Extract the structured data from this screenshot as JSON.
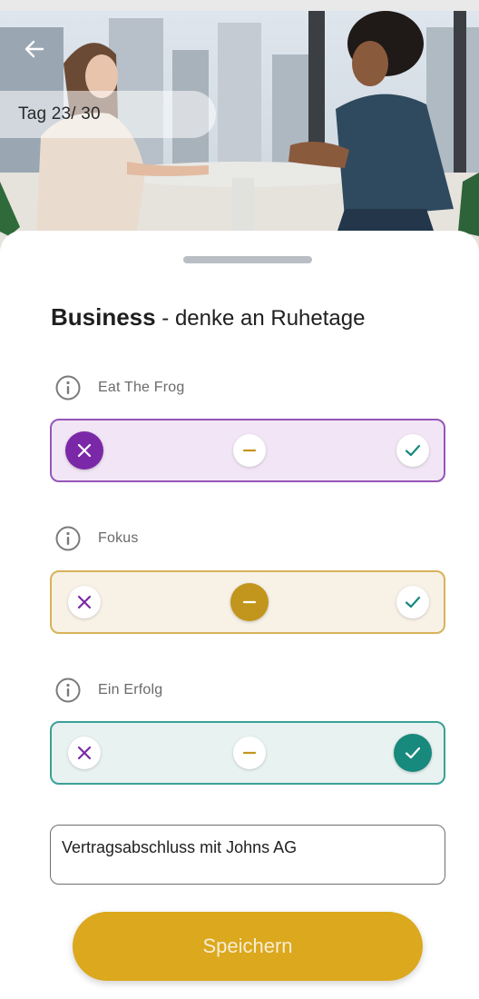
{
  "header": {
    "back_icon": "arrow-left-icon",
    "day_label": "Tag 23/ 30"
  },
  "sheet": {
    "title_bold": "Business",
    "title_rest": " - denke an Ruhetage"
  },
  "questions": [
    {
      "label": "Eat The Frog",
      "selected": "no",
      "accent": "#7b28a8",
      "fill": "#f2e6f6",
      "border": "#9556b8"
    },
    {
      "label": "Fokus",
      "selected": "neutral",
      "accent": "#c2961c",
      "fill": "#f7f1e6",
      "border": "#d7b35a"
    },
    {
      "label": "Ein Erfolg",
      "selected": "yes",
      "accent": "#17897d",
      "fill": "#e8f2f1",
      "border": "#3aa196"
    }
  ],
  "note": {
    "value": "Vertragsabschluss mit Johns AG"
  },
  "actions": {
    "save_label": "Speichern",
    "save_color": "#dba81e"
  },
  "colors": {
    "no": "#7b28a8",
    "neutral": "#c2961c",
    "yes": "#17897d"
  }
}
